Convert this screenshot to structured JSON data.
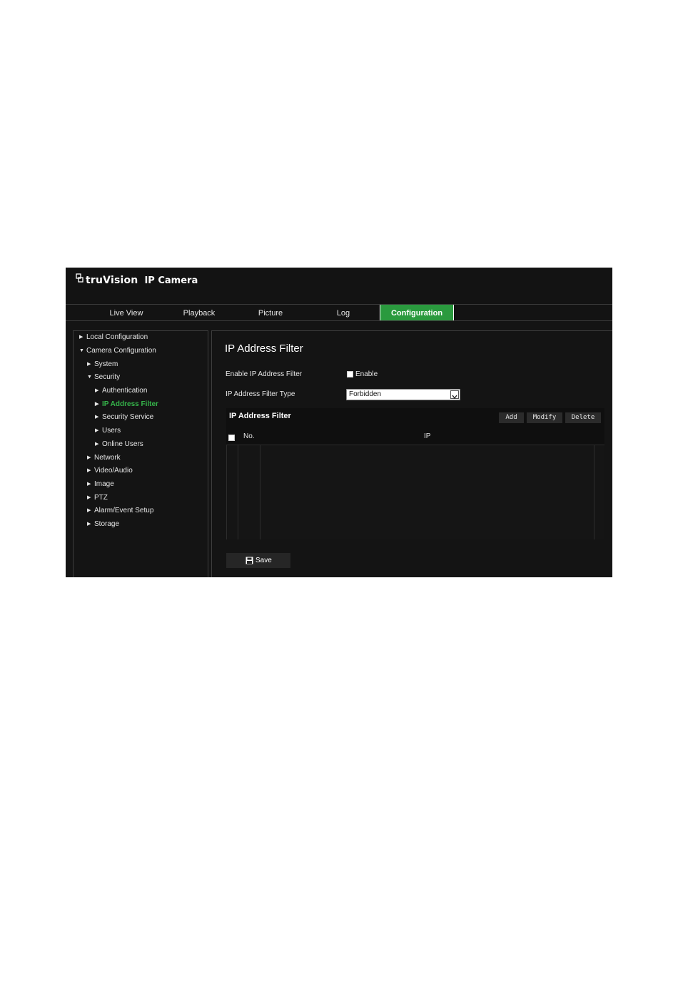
{
  "header": {
    "brand_name": "truVision",
    "product_name": "IP Camera"
  },
  "nav": {
    "tabs": [
      {
        "label": "Live View"
      },
      {
        "label": "Playback"
      },
      {
        "label": "Picture"
      },
      {
        "label": "Log"
      },
      {
        "label": "Configuration",
        "active": true
      }
    ]
  },
  "sidebar": {
    "items": [
      {
        "label": "Local Configuration",
        "expanded": false
      },
      {
        "label": "Camera Configuration",
        "expanded": true
      },
      {
        "label": "System",
        "expanded": false
      },
      {
        "label": "Security",
        "expanded": true
      },
      {
        "label": "Authentication"
      },
      {
        "label": "IP Address Filter",
        "selected": true
      },
      {
        "label": "Security Service"
      },
      {
        "label": "Users"
      },
      {
        "label": "Online Users"
      },
      {
        "label": "Network"
      },
      {
        "label": "Video/Audio"
      },
      {
        "label": "Image"
      },
      {
        "label": "PTZ"
      },
      {
        "label": "Alarm/Event Setup"
      },
      {
        "label": "Storage"
      }
    ]
  },
  "main": {
    "title": "IP Address Filter",
    "enable_label": "Enable IP Address Filter",
    "enable_checkbox_text": "Enable",
    "enable_checked": false,
    "type_label": "IP Address Filter Type",
    "type_value": "Forbidden",
    "panel": {
      "title": "IP Address Filter",
      "buttons": {
        "add": "Add",
        "modify": "Modify",
        "delete": "Delete"
      },
      "columns": {
        "no": "No.",
        "ip": "IP"
      },
      "rows": []
    },
    "save_label": "Save"
  },
  "colors": {
    "accent": "#2a9a3e",
    "selected_text": "#35b34a",
    "background": "#141414"
  }
}
